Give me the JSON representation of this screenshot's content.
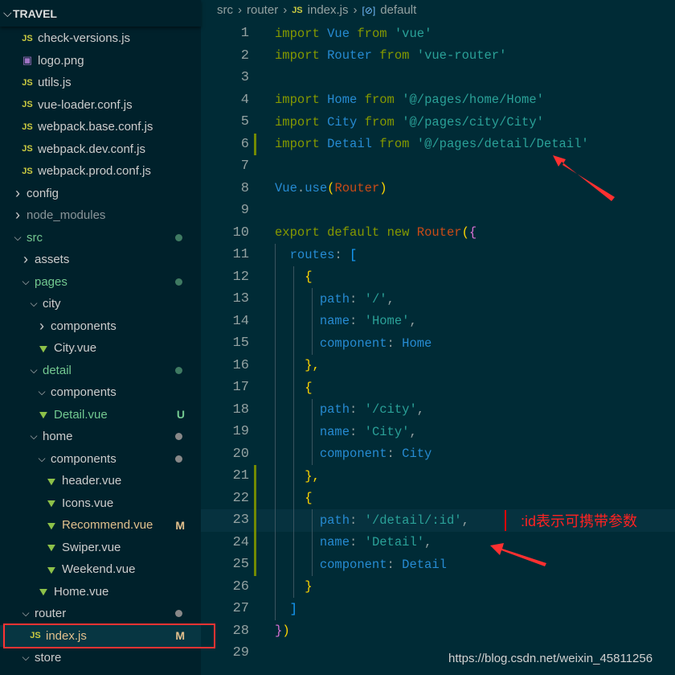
{
  "explorer": {
    "title": "TRAVEL",
    "items": [
      {
        "label": "check-versions.js",
        "icon": "js-file-icon",
        "depth": 2,
        "type": "file"
      },
      {
        "label": "logo.png",
        "icon": "image-file-icon",
        "depth": 2,
        "type": "file"
      },
      {
        "label": "utils.js",
        "icon": "js-file-icon",
        "depth": 2,
        "type": "file"
      },
      {
        "label": "vue-loader.conf.js",
        "icon": "js-file-icon",
        "depth": 2,
        "type": "file"
      },
      {
        "label": "webpack.base.conf.js",
        "icon": "js-file-icon",
        "depth": 2,
        "type": "file"
      },
      {
        "label": "webpack.dev.conf.js",
        "icon": "js-file-icon",
        "depth": 2,
        "type": "file"
      },
      {
        "label": "webpack.prod.conf.js",
        "icon": "js-file-icon",
        "depth": 2,
        "type": "file"
      },
      {
        "label": "config",
        "depth": 1,
        "type": "folder",
        "open": false
      },
      {
        "label": "node_modules",
        "depth": 1,
        "type": "folder",
        "open": false,
        "dim": true
      },
      {
        "label": "src",
        "depth": 1,
        "type": "folder",
        "open": true,
        "git": "u",
        "dot": "green"
      },
      {
        "label": "assets",
        "depth": 2,
        "type": "folder",
        "open": false
      },
      {
        "label": "pages",
        "depth": 2,
        "type": "folder",
        "open": true,
        "git": "u",
        "dot": "green"
      },
      {
        "label": "city",
        "depth": 3,
        "type": "folder",
        "open": true
      },
      {
        "label": "components",
        "depth": 4,
        "type": "folder",
        "open": false
      },
      {
        "label": "City.vue",
        "icon": "vue-file-icon",
        "depth": 4,
        "type": "file"
      },
      {
        "label": "detail",
        "depth": 3,
        "type": "folder",
        "open": true,
        "git": "u",
        "dot": "green"
      },
      {
        "label": "components",
        "depth": 4,
        "type": "folder",
        "open": true
      },
      {
        "label": "Detail.vue",
        "icon": "vue-file-icon",
        "depth": 4,
        "type": "file",
        "git": "u",
        "badge": "U"
      },
      {
        "label": "home",
        "depth": 3,
        "type": "folder",
        "open": true,
        "dot": "gray"
      },
      {
        "label": "components",
        "depth": 4,
        "type": "folder",
        "open": true,
        "dot": "gray"
      },
      {
        "label": "header.vue",
        "icon": "vue-file-icon",
        "depth": 5,
        "type": "file"
      },
      {
        "label": "Icons.vue",
        "icon": "vue-file-icon",
        "depth": 5,
        "type": "file"
      },
      {
        "label": "Recommend.vue",
        "icon": "vue-file-icon",
        "depth": 5,
        "type": "file",
        "git": "m",
        "badge": "M"
      },
      {
        "label": "Swiper.vue",
        "icon": "vue-file-icon",
        "depth": 5,
        "type": "file"
      },
      {
        "label": "Weekend.vue",
        "icon": "vue-file-icon",
        "depth": 5,
        "type": "file"
      },
      {
        "label": "Home.vue",
        "icon": "vue-file-icon",
        "depth": 4,
        "type": "file"
      },
      {
        "label": "router",
        "depth": 2,
        "type": "folder",
        "open": true,
        "dot": "gray"
      },
      {
        "label": "index.js",
        "icon": "js-file-icon",
        "depth": 3,
        "type": "file",
        "git": "m",
        "badge": "M",
        "selected": true
      },
      {
        "label": "store",
        "depth": 2,
        "type": "folder",
        "open": true
      }
    ]
  },
  "breadcrumb": {
    "parts": [
      "src",
      "router",
      "index.js",
      "default"
    ]
  },
  "editor": {
    "current_line": 23,
    "modified_lines": [
      6,
      21,
      22,
      23,
      24,
      25
    ],
    "lines": [
      [
        [
          "import",
          "kw"
        ],
        [
          " "
        ],
        [
          "Vue",
          "id"
        ],
        [
          " "
        ],
        [
          "from",
          "kw"
        ],
        [
          " "
        ],
        [
          "'vue'",
          "str"
        ]
      ],
      [
        [
          "import",
          "kw"
        ],
        [
          " "
        ],
        [
          "Router",
          "id"
        ],
        [
          " "
        ],
        [
          "from",
          "kw"
        ],
        [
          " "
        ],
        [
          "'vue-router'",
          "str"
        ]
      ],
      [],
      [
        [
          "import",
          "kw"
        ],
        [
          " "
        ],
        [
          "Home",
          "id"
        ],
        [
          " "
        ],
        [
          "from",
          "kw"
        ],
        [
          " "
        ],
        [
          "'@/pages/home/Home'",
          "str"
        ]
      ],
      [
        [
          "import",
          "kw"
        ],
        [
          " "
        ],
        [
          "City",
          "id"
        ],
        [
          " "
        ],
        [
          "from",
          "kw"
        ],
        [
          " "
        ],
        [
          "'@/pages/city/City'",
          "str"
        ]
      ],
      [
        [
          "import",
          "kw"
        ],
        [
          " "
        ],
        [
          "Detail",
          "id"
        ],
        [
          " "
        ],
        [
          "from",
          "kw"
        ],
        [
          " "
        ],
        [
          "'@/pages/detail/Detail'",
          "str"
        ]
      ],
      [],
      [
        [
          "Vue",
          "id"
        ],
        [
          ".",
          "pn"
        ],
        [
          "use",
          "id"
        ],
        [
          "(",
          "br1"
        ],
        [
          "Router",
          "fn"
        ],
        [
          ")",
          "br1"
        ]
      ],
      [],
      [
        [
          "export",
          "kw"
        ],
        [
          " "
        ],
        [
          "default",
          "kw"
        ],
        [
          " "
        ],
        [
          "new",
          "kw"
        ],
        [
          " "
        ],
        [
          "Router",
          "fn"
        ],
        [
          "(",
          "br1"
        ],
        [
          "{",
          "br2"
        ]
      ],
      [
        [
          "  "
        ],
        [
          "routes",
          "id"
        ],
        [
          ": ",
          "pn"
        ],
        [
          "[",
          "br3"
        ]
      ],
      [
        [
          "    "
        ],
        [
          "{",
          "br1"
        ]
      ],
      [
        [
          "      "
        ],
        [
          "path",
          "id"
        ],
        [
          ": ",
          "pn"
        ],
        [
          "'/'",
          "str"
        ],
        [
          ",",
          "pn"
        ]
      ],
      [
        [
          "      "
        ],
        [
          "name",
          "id"
        ],
        [
          ": ",
          "pn"
        ],
        [
          "'Home'",
          "str"
        ],
        [
          ",",
          "pn"
        ]
      ],
      [
        [
          "      "
        ],
        [
          "component",
          "id"
        ],
        [
          ": ",
          "pn"
        ],
        [
          "Home",
          "id"
        ]
      ],
      [
        [
          "    "
        ],
        [
          "},",
          "br1"
        ]
      ],
      [
        [
          "    "
        ],
        [
          "{",
          "br1"
        ]
      ],
      [
        [
          "      "
        ],
        [
          "path",
          "id"
        ],
        [
          ": ",
          "pn"
        ],
        [
          "'/city'",
          "str"
        ],
        [
          ",",
          "pn"
        ]
      ],
      [
        [
          "      "
        ],
        [
          "name",
          "id"
        ],
        [
          ": ",
          "pn"
        ],
        [
          "'City'",
          "str"
        ],
        [
          ",",
          "pn"
        ]
      ],
      [
        [
          "      "
        ],
        [
          "component",
          "id"
        ],
        [
          ": ",
          "pn"
        ],
        [
          "City",
          "id"
        ]
      ],
      [
        [
          "    "
        ],
        [
          "},",
          "br1"
        ]
      ],
      [
        [
          "    "
        ],
        [
          "{",
          "br1"
        ]
      ],
      [
        [
          "      "
        ],
        [
          "path",
          "id"
        ],
        [
          ": ",
          "pn"
        ],
        [
          "'/detail/:id'",
          "str"
        ],
        [
          ",",
          "pn"
        ]
      ],
      [
        [
          "      "
        ],
        [
          "name",
          "id"
        ],
        [
          ": ",
          "pn"
        ],
        [
          "'Detail'",
          "str"
        ],
        [
          ",",
          "pn"
        ]
      ],
      [
        [
          "      "
        ],
        [
          "component",
          "id"
        ],
        [
          ": ",
          "pn"
        ],
        [
          "Detail",
          "id"
        ]
      ],
      [
        [
          "    "
        ],
        [
          "}",
          "br1"
        ]
      ],
      [
        [
          "  "
        ],
        [
          "]",
          "br3"
        ]
      ],
      [
        [
          "}",
          "br2"
        ],
        [
          ")",
          "br1"
        ]
      ],
      []
    ]
  },
  "annotation": ":id表示可携带参数",
  "watermark": "https://blog.csdn.net/weixin_45811256",
  "colors": {
    "keyword": "#859900",
    "identifier": "#268bd2",
    "string": "#2aa198",
    "annotation": "#ff2222",
    "git_untracked": "#73c991",
    "git_modified": "#e2c08d"
  }
}
